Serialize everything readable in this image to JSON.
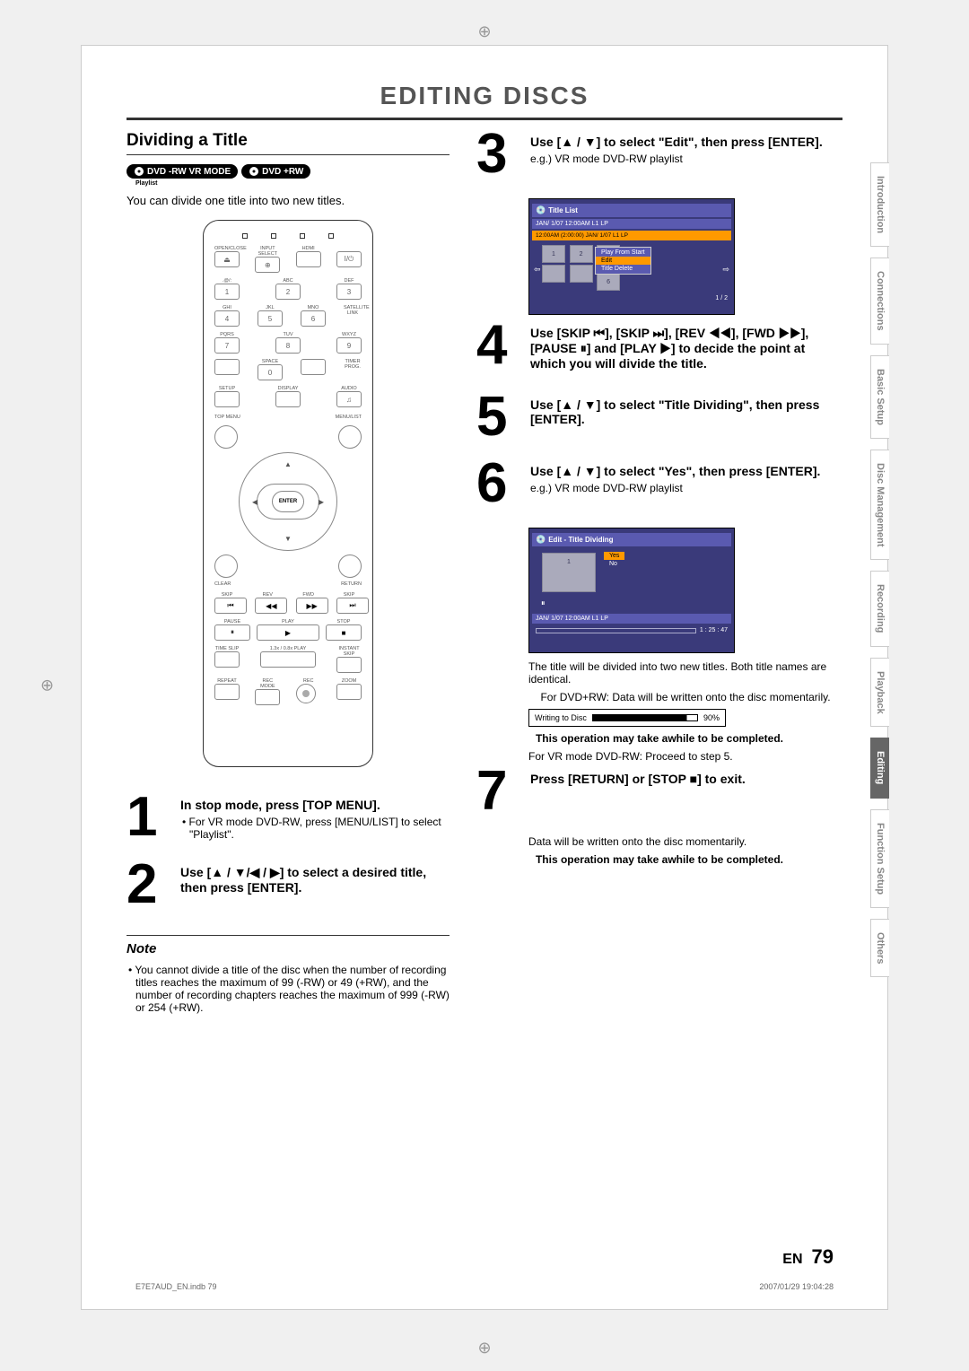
{
  "header": "EDITING DISCS",
  "section": "Dividing a Title",
  "badges": [
    "DVD -RW VR MODE",
    "DVD +RW"
  ],
  "playlist_caption": "Playlist",
  "intro": "You can divide one title into two new titles.",
  "remote": {
    "labels_row1": [
      "OPEN/CLOSE",
      "INPUT SELECT",
      "HDMI",
      ""
    ],
    "power": "I/⏻",
    "num_rows": [
      {
        "labels": [
          ".@/:",
          "ABC",
          "DEF"
        ],
        "keys": [
          "1",
          "2",
          "3"
        ]
      },
      {
        "labels": [
          "GHI",
          "JKL",
          "MNO"
        ],
        "keys": [
          "4",
          "5",
          "6"
        ],
        "side": "SATELLITE LINK"
      },
      {
        "labels": [
          "PQRS",
          "TUV",
          "WXYZ"
        ],
        "keys": [
          "7",
          "8",
          "9"
        ]
      },
      {
        "labels": [
          "",
          "SPACE",
          ""
        ],
        "keys": [
          "",
          "0",
          ""
        ],
        "side": "TIMER PROG."
      }
    ],
    "row_setup": [
      "SETUP",
      "DISPLAY",
      "AUDIO"
    ],
    "top_menu": "TOP MENU",
    "menu_list": "MENU/LIST",
    "enter": "ENTER",
    "clear": "CLEAR",
    "return": "RETURN",
    "transport_labels": [
      "SKIP",
      "REV",
      "FWD",
      "SKIP"
    ],
    "transport2": [
      "PAUSE",
      "PLAY",
      "STOP"
    ],
    "row_timeslip": [
      "TIME SLIP",
      "1.3x / 0.8x PLAY",
      "INSTANT SKIP"
    ],
    "bottom": [
      "REPEAT",
      "REC MODE",
      "REC",
      "ZOOM"
    ]
  },
  "steps_left": [
    {
      "n": "1",
      "title": "In stop mode, press [TOP MENU].",
      "bullet": "• For VR mode DVD-RW, press [MENU/LIST] to select \"Playlist\"."
    },
    {
      "n": "2",
      "title": "Use [▲ / ▼/◀ / ▶] to select a desired title, then press [ENTER]."
    }
  ],
  "steps_right": [
    {
      "n": "3",
      "title": "Use [▲ / ▼] to select \"Edit\", then press [ENTER].",
      "sub": "e.g.) VR mode DVD-RW playlist"
    },
    {
      "n": "4",
      "title": "Use [SKIP ⏮], [SKIP ⏭], [REV ◀◀], [FWD ▶▶], [PAUSE ⏸] and [PLAY ▶] to decide the point at which you will divide the title."
    },
    {
      "n": "5",
      "title": "Use [▲ / ▼] to select \"Title Dividing\", then press [ENTER]."
    },
    {
      "n": "6",
      "title": "Use [▲ / ▼] to select \"Yes\", then press [ENTER].",
      "sub": "e.g.) VR mode DVD-RW playlist"
    },
    {
      "n": "7",
      "title": "Press [RETURN] or [STOP ■] to exit."
    }
  ],
  "screenshot1": {
    "title": "Title List",
    "info": "JAN/ 1/07 12:00AM   L1   LP",
    "sub": "12:00AM (2:00:00)   JAN/  1/07         L1   LP",
    "thumbs": [
      "1",
      "2",
      "3",
      "",
      "",
      "6"
    ],
    "menu": [
      "Play From Start",
      "Edit",
      "Title Delete"
    ],
    "footer": "1 / 2"
  },
  "screenshot2": {
    "title": "Edit - Title Dividing",
    "thumb": "1",
    "options": [
      "Yes",
      "No"
    ],
    "info": "JAN/ 1/07 12:00AM   L1   LP",
    "time": "1 : 25 : 47"
  },
  "after6_p1": "The title will be divided into two new titles. Both title names are identical.",
  "after6_p2": "For DVD+RW: Data will be written onto the disc momentarily.",
  "progress": {
    "label": "Writing to Disc",
    "pct": "90%"
  },
  "warn": "This operation may take awhile to be completed.",
  "after6_p3": "For VR mode DVD-RW: Proceed to step 5.",
  "after7": "Data will be written onto the disc momentarily.",
  "note_title": "Note",
  "note_body": "• You cannot divide a title of the disc when the number of recording titles reaches the maximum of 99 (-RW) or 49 (+RW), and the number of recording chapters reaches the maximum of 999 (-RW) or 254 (+RW).",
  "tabs": [
    "Introduction",
    "Connections",
    "Basic Setup",
    "Disc Management",
    "Recording",
    "Playback",
    "Editing",
    "Function Setup",
    "Others"
  ],
  "active_tab": "Editing",
  "page_no": {
    "lang": "EN",
    "num": "79"
  },
  "footer_left": "E7E7AUD_EN.indb   79",
  "footer_right": "2007/01/29   19:04:28"
}
